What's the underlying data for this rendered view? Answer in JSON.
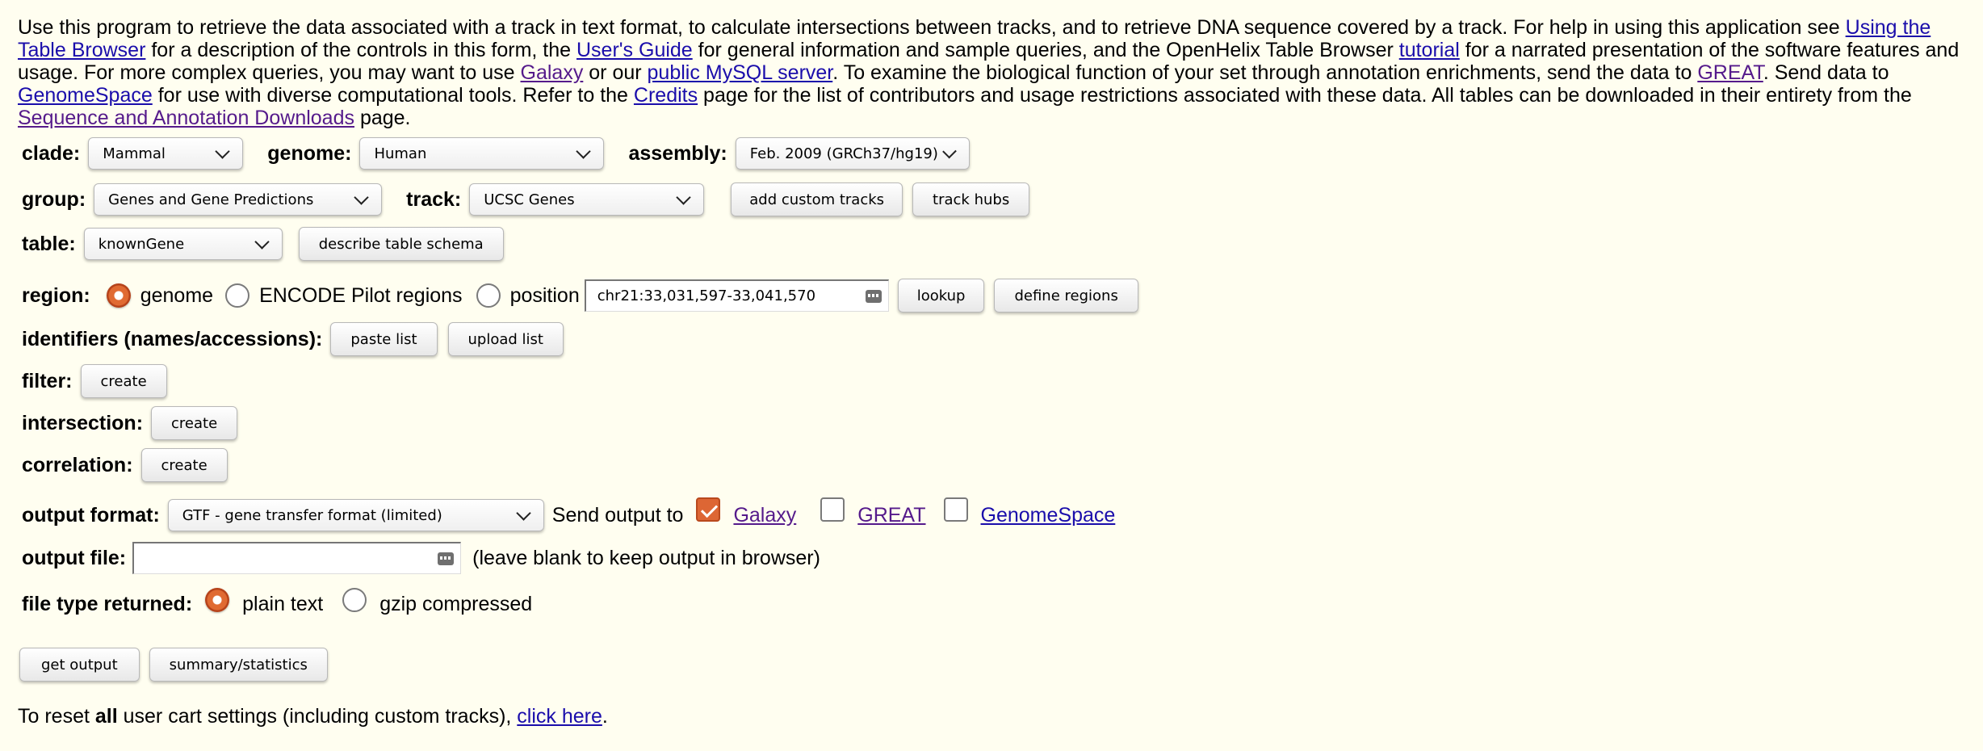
{
  "intro": {
    "t1": "Use this program to retrieve the data associated with a track in text format, to calculate intersections between tracks, and to retrieve DNA sequence covered by a track. For help in using this application see ",
    "l1": "Using the Table Browser",
    "t2": " for a description of the controls in this form, the ",
    "l2": "User's Guide",
    "t3": " for general information and sample queries, and the OpenHelix Table Browser ",
    "l3": "tutorial",
    "t4": " for a narrated presentation of the software features and usage. For more complex queries, you may want to use ",
    "l4": "Galaxy",
    "t5": " or our ",
    "l5": "public MySQL server",
    "t6": ". To examine the biological function of your set through annotation enrichments, send the data to ",
    "l6": "GREAT",
    "t7": ". Send data to ",
    "l7": "GenomeSpace",
    "t8": " for use with diverse computational tools. Refer to the ",
    "l8": "Credits",
    "t9": " page for the list of contributors and usage restrictions associated with these data. All tables can be downloaded in their entirety from the ",
    "l9": "Sequence and Annotation Downloads",
    "t10": " page."
  },
  "clade": {
    "label": "clade:",
    "value": "Mammal"
  },
  "genome": {
    "label": "genome:",
    "value": "Human"
  },
  "assembly": {
    "label": "assembly:",
    "value": "Feb. 2009 (GRCh37/hg19)"
  },
  "group": {
    "label": "group:",
    "value": "Genes and Gene Predictions"
  },
  "track": {
    "label": "track:",
    "value": "UCSC Genes"
  },
  "buttons": {
    "add_custom_tracks": "add custom tracks",
    "track_hubs": "track hubs",
    "describe_table_schema": "describe table schema",
    "lookup": "lookup",
    "define_regions": "define regions",
    "paste_list": "paste list",
    "upload_list": "upload list",
    "filter_create": "create",
    "intersection_create": "create",
    "correlation_create": "create",
    "get_output": "get output",
    "summary_statistics": "summary/statistics"
  },
  "table": {
    "label": "table:",
    "value": "knownGene"
  },
  "region": {
    "label": "region:",
    "opt_genome": "genome",
    "opt_encode": "ENCODE Pilot regions",
    "opt_position": "position",
    "position_value": "chr21:33,031,597-33,041,570",
    "selected": "genome"
  },
  "identifiers": {
    "label": "identifiers (names/accessions):"
  },
  "filter": {
    "label": "filter:"
  },
  "intersection": {
    "label": "intersection:"
  },
  "correlation": {
    "label": "correlation:"
  },
  "output_format": {
    "label": "output format:",
    "value": "GTF - gene transfer format (limited)",
    "send_to": "Send output to",
    "galaxy": "Galaxy",
    "great": "GREAT",
    "genomespace": "GenomeSpace",
    "galaxy_checked": true
  },
  "output_file": {
    "label": "output file:",
    "value": "",
    "hint": "(leave blank to keep output in browser)"
  },
  "file_type": {
    "label": "file type returned:",
    "plain": "plain text",
    "gzip": "gzip compressed",
    "selected": "plain text"
  },
  "reset": {
    "t1": "To reset ",
    "bold": "all",
    "t2": " user cart settings (including custom tracks), ",
    "link": "click here",
    "t3": "."
  },
  "colors": {
    "accent": "#dd6634",
    "link": "#1a0dab",
    "visited": "#551a8b",
    "background": "#fffef0"
  }
}
